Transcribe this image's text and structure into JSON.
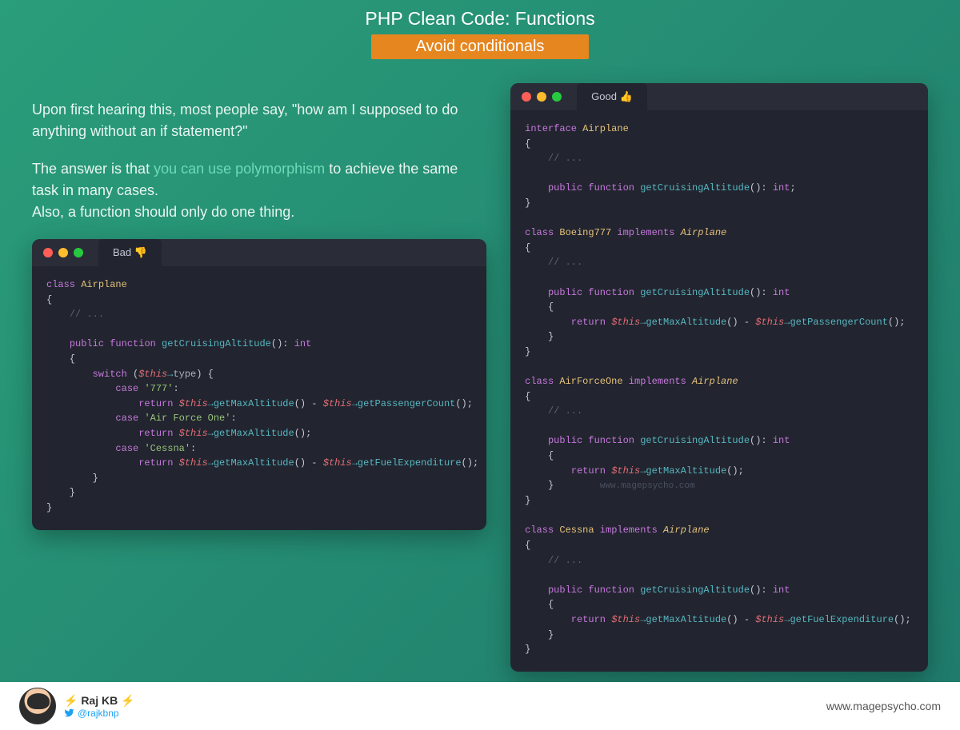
{
  "header": {
    "title": "PHP Clean Code: Functions",
    "subtitle": "Avoid conditionals"
  },
  "description": {
    "para1": "Upon first hearing this, most people say, \"how am I supposed to do anything without an if statement?\"",
    "para2_pre": "The answer is that ",
    "para2_highlight": "you can use polymorphism",
    "para2_post": " to achieve the same task in many cases.",
    "para3": "Also, a function should only do one thing."
  },
  "bad_window": {
    "tab_label": "Bad 👎"
  },
  "good_window": {
    "tab_label": "Good 👍",
    "watermark": "www.magepsycho.com"
  },
  "code_tokens": {
    "class": "class",
    "interface": "interface",
    "implements": "implements",
    "public": "public",
    "function": "function",
    "return": "return",
    "switch": "switch",
    "case": "case",
    "int": "int",
    "this": "$this",
    "arrow": "→",
    "comment_dots": "// ...",
    "Airplane": "Airplane",
    "Boeing777": "Boeing777",
    "AirForceOne": "AirForceOne",
    "Cessna": "Cessna",
    "getCruisingAltitude": "getCruisingAltitude",
    "getMaxAltitude": "getMaxAltitude",
    "getPassengerCount": "getPassengerCount",
    "getFuelExpenditure": "getFuelExpenditure",
    "type_prop": "type",
    "str_777": "'777'",
    "str_afo": "'Air Force One'",
    "str_cessna": "'Cessna'"
  },
  "footer": {
    "author_name": "⚡ Raj KB ⚡",
    "author_handle": "@rajkbnp",
    "site": "www.magepsycho.com"
  }
}
